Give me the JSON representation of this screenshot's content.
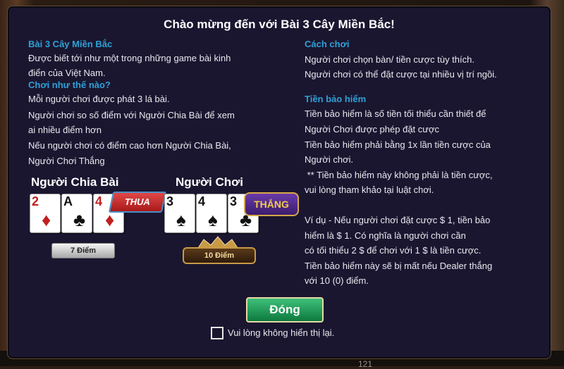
{
  "title": "Chào mừng đến với Bài 3 Cây Miền Bắc!",
  "left": {
    "heading1": "Bài 3 Cây Miền Bắc",
    "intro": [
      "Được biết tới như một trong những game bài kinh",
      "điển của Việt Nam."
    ],
    "heading2": "Chơi như thế nào?",
    "rules": [
      "Mỗi người chơi được phát 3 lá bài.",
      "Người chơi so số điểm với Người Chia Bài để xem",
      "ai nhiều điểm hơn",
      "Nếu người chơi có điểm cao hơn Người Chia Bài,",
      "Người Chơi Thắng"
    ]
  },
  "example": {
    "dealer": {
      "label": "Người Chia Bài",
      "cards": [
        {
          "rank": "2",
          "suit": "♦"
        },
        {
          "rank": "A",
          "suit": "♣"
        },
        {
          "rank": "4",
          "suit": "♦"
        }
      ],
      "result": "THUA",
      "score": "7 Điểm"
    },
    "player": {
      "label": "Người Chơi",
      "cards": [
        {
          "rank": "3",
          "suit": "♠"
        },
        {
          "rank": "4",
          "suit": "♠"
        },
        {
          "rank": "3",
          "suit": "♣"
        }
      ],
      "result": "THẮNG",
      "score": "10 Điểm"
    }
  },
  "right": {
    "heading1": "Cách chơi",
    "howto": [
      "Người chơi chọn bàn/ tiền cược tùy thích.",
      "Người chơi có thể đặt cược tại nhiều vị trí ngồi."
    ],
    "heading2": "Tiền bảo hiểm",
    "insurance": [
      "Tiền bảo hiểm là số tiền tối thiểu cần thiết để",
      "Người Chơi được phép đặt cược",
      "Tiền bảo hiểm phải bằng 1x lần tiền cược của",
      "Người chơi.",
      " ** Tiền bảo hiểm này không phải là tiền cược,",
      "vui lòng tham khảo tại luật chơi."
    ],
    "example": [
      "Ví dụ - Nếu người chơi đặt cược $ 1, tiền bảo",
      "hiểm là $ 1. Có nghĩa là người chơi cần",
      "có tối thiểu 2 $ để chơi với 1 $ là tiền cược.",
      "Tiền bảo hiểm này sẽ bị mất nếu Dealer thắng",
      "với 10 (0) điểm."
    ]
  },
  "close_label": "Đóng",
  "dont_show_label": "Vui lòng không hiển thị lại.",
  "bg_number": "121",
  "colors": {
    "accent": "#2fa1d6",
    "panel": "#1b1630",
    "button": "#1f9a55"
  }
}
